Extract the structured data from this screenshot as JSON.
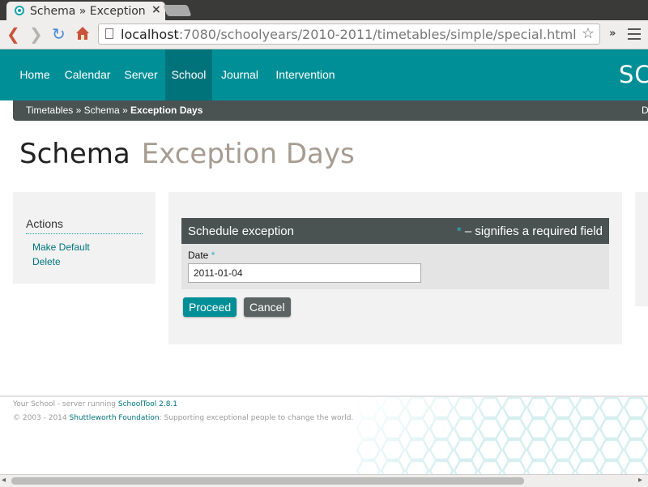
{
  "browser": {
    "tab_title": "Schema » Exception D",
    "close_glyph": "×",
    "url_host": "localhost",
    "url_rest": ":7080/schoolyears/2010-2011/timetables/simple/special.html",
    "extensions_glyph": "»",
    "star_glyph": "☆",
    "back_glyph": "❮",
    "forward_glyph": "❯",
    "reload_glyph": "↻"
  },
  "nav": {
    "items": [
      {
        "label": "Home"
      },
      {
        "label": "Calendar"
      },
      {
        "label": "Server"
      },
      {
        "label": "School",
        "active": true
      },
      {
        "label": "Journal"
      },
      {
        "label": "Intervention"
      }
    ],
    "brand": "SC"
  },
  "breadcrumb": {
    "items": [
      "Timetables",
      "Schema"
    ],
    "separator": "»",
    "current": "Exception Days",
    "right_text": "D"
  },
  "page": {
    "title": "Schema",
    "subtitle": "Exception Days"
  },
  "sidebar": {
    "heading": "Actions",
    "links": [
      "Make Default",
      "Delete"
    ]
  },
  "form": {
    "legend": "Schedule exception",
    "required_star": "*",
    "required_note": "– signifies a required field",
    "date_label": "Date",
    "date_value": "2011-01-04",
    "proceed_label": "Proceed",
    "cancel_label": "Cancel"
  },
  "footer": {
    "line1_prefix": "Your School - server running",
    "line1_link": "SchoolTool 2.8.1",
    "line2_prefix": "© 2003 - 2014",
    "line2_link": "Shuttleworth Foundation",
    "line2_suffix": ": Supporting exceptional people to change the world."
  },
  "colors": {
    "brand_teal": "#008f96",
    "active_nav": "#00737a",
    "dark_bar": "#4a5252",
    "subtitle": "#a69c92"
  }
}
